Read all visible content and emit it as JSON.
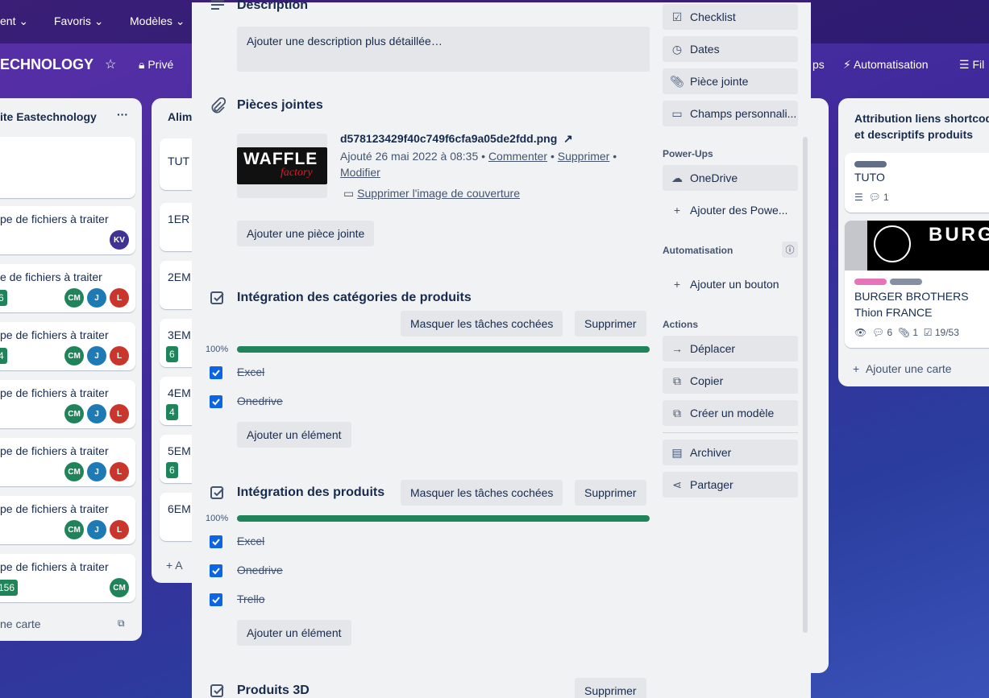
{
  "background": {
    "nav": {
      "menu_partial": "ent",
      "favorites": "Favoris",
      "templates": "Modèles"
    },
    "board": {
      "title": "ECHNOLOGY",
      "visibility": "Privé",
      "right_partial": "ps",
      "automation": "Automatisation",
      "filter": "Fil"
    },
    "list1": {
      "title": "ite Eastechnology",
      "cards": [
        {
          "title": "pe de fichiers à traiter",
          "badge": "",
          "avatars": [
            "KV"
          ]
        },
        {
          "title": "e de fichiers à traiter",
          "badge": "6",
          "avatars": [
            "CM",
            "J",
            "L"
          ]
        },
        {
          "title": "pe de fichiers à traiter",
          "badge": "4",
          "avatars": [
            "CM",
            "J",
            "L"
          ]
        },
        {
          "title": "pe de fichiers à traiter",
          "badge": "",
          "avatars": [
            "CM",
            "J",
            "L"
          ]
        },
        {
          "title": "pe de fichiers à traiter",
          "badge": "",
          "avatars": [
            "CM",
            "J",
            "L"
          ]
        },
        {
          "title": "pe de fichiers à traiter",
          "badge": "",
          "avatars": [
            "CM",
            "J",
            "L"
          ]
        },
        {
          "title": "pe de fichiers à traiter",
          "badge": "156",
          "avatars": [
            "CM"
          ]
        }
      ],
      "add_card": "ne carte"
    },
    "list2": {
      "title": "Alim",
      "cards": [
        "TUT",
        "1ER",
        "2EM",
        "3EM",
        "4EM",
        "5EM",
        "6EM"
      ],
      "badges": [
        "",
        "",
        "",
        "6",
        "4",
        "6",
        ""
      ],
      "add_card": "A"
    },
    "list3": {
      "title": "Attribution liens shortcod et descriptifs produits",
      "card1": {
        "title": "TUTO",
        "comments": "1"
      },
      "card2": {
        "cover": "BURGE BR·TH",
        "title": "BURGER BROTHERS Thion FRANCE",
        "comments": "6",
        "attachments": "1",
        "checklist": "19/53"
      },
      "add_card": "Ajouter une carte"
    }
  },
  "description": {
    "title": "Description",
    "placeholder": "Ajouter une description plus détaillée…"
  },
  "attachments": {
    "title": "Pièces jointes",
    "file": {
      "name": "d578123429f40c749f6cfa9a05de2fdd.png",
      "thumb_line1": "WAFFLE",
      "thumb_line2": "factory",
      "added": "Ajouté 26 mai 2022 à 08:35",
      "comment": "Commenter",
      "delete": "Supprimer",
      "edit": "Modifier",
      "remove_cover": "Supprimer l'image de couverture"
    },
    "add_button": "Ajouter une pièce jointe"
  },
  "checklists": [
    {
      "title": "Intégration des catégories de produits",
      "hide_checked": "Masquer les tâches cochées",
      "delete": "Supprimer",
      "percent_label": "100%",
      "progress": 1.0,
      "items": [
        "Excel",
        "Onedrive"
      ],
      "add_item": "Ajouter un élément"
    },
    {
      "title": "Intégration des produits",
      "hide_checked": "Masquer les tâches cochées",
      "delete": "Supprimer",
      "percent_label": "100%",
      "progress": 1.0,
      "items": [
        "Excel",
        "Onedrive",
        "Trello"
      ],
      "add_item": "Ajouter un élément"
    },
    {
      "title": "Produits 3D",
      "delete": "Supprimer"
    }
  ],
  "sidebar": {
    "add_to_card": [
      "Checklist",
      "Dates",
      "Pièce jointe",
      "Champs personnali..."
    ],
    "powerups_label": "Power-Ups",
    "powerups": [
      "OneDrive",
      "Ajouter des Powe..."
    ],
    "automation_label": "Automatisation",
    "automation_add": "Ajouter un bouton",
    "actions_label": "Actions",
    "actions": [
      "Déplacer",
      "Copier",
      "Créer un modèle"
    ],
    "actions2": [
      "Archiver",
      "Partager"
    ]
  },
  "colors": {
    "accent": "#0c66e4",
    "success": "#1f845a",
    "bg_purple": "#4a2ba0"
  }
}
